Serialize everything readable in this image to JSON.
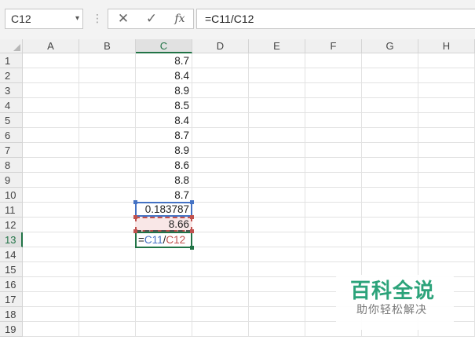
{
  "formula_bar": {
    "name_box": "C12",
    "name_box_arrow": "▾",
    "separator": "⋮",
    "cancel_glyph": "✕",
    "enter_glyph": "✓",
    "insert_function": "fx",
    "formula": "=C11/C12"
  },
  "columns": [
    "A",
    "B",
    "C",
    "D",
    "E",
    "F",
    "G",
    "H"
  ],
  "active_column": "C",
  "rows": [
    "1",
    "2",
    "3",
    "4",
    "5",
    "6",
    "7",
    "8",
    "9",
    "10",
    "11",
    "12",
    "13",
    "14",
    "15",
    "16",
    "17",
    "18",
    "19"
  ],
  "active_row": "13",
  "column_c_values": [
    "8.7",
    "8.4",
    "8.9",
    "8.5",
    "8.4",
    "8.7",
    "8.9",
    "8.6",
    "8.8",
    "8.7"
  ],
  "c11": "0.183787",
  "c12": "8.66",
  "edit_cell": {
    "prefix": "=",
    "ref1": "C11",
    "operator": "/",
    "ref2": "C12"
  },
  "colors": {
    "accent_green": "#217346",
    "ref_blue": "#4472c4",
    "ref_red": "#c0504d",
    "watermark_green": "#2ca37a"
  },
  "watermark": {
    "title": "百科全说",
    "subtitle": "助你轻松解决"
  }
}
